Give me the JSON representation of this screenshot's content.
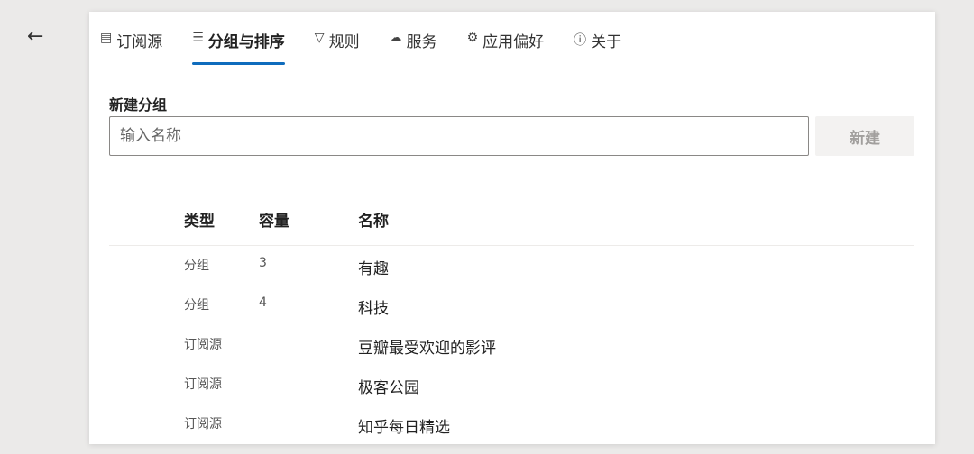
{
  "nav": {
    "back_icon": "arrow-left-icon"
  },
  "tabs": [
    {
      "label": "订阅源",
      "icon": "feed-icon",
      "glyph": "▤"
    },
    {
      "label": "分组与排序",
      "icon": "list-icon",
      "glyph": "☰",
      "active": true
    },
    {
      "label": "规则",
      "icon": "filter-icon",
      "glyph": "▽"
    },
    {
      "label": "服务",
      "icon": "cloud-upload-icon",
      "glyph": "☁"
    },
    {
      "label": "应用偏好",
      "icon": "gear-icon",
      "glyph": "⚙"
    },
    {
      "label": "关于",
      "icon": "info-icon",
      "glyph": "ⓘ"
    }
  ],
  "new_group": {
    "label": "新建分组",
    "placeholder": "输入名称",
    "value": "",
    "button": "新建"
  },
  "accent": "#0f6cbd",
  "table": {
    "headers": [
      "类型",
      "容量",
      "名称"
    ],
    "rows": [
      {
        "type": "分组",
        "count": "3",
        "name": "有趣"
      },
      {
        "type": "分组",
        "count": "4",
        "name": "科技"
      },
      {
        "type": "订阅源",
        "count": "",
        "name": "豆瓣最受欢迎的影评"
      },
      {
        "type": "订阅源",
        "count": "",
        "name": "极客公园"
      },
      {
        "type": "订阅源",
        "count": "",
        "name": "知乎每日精选"
      }
    ]
  }
}
